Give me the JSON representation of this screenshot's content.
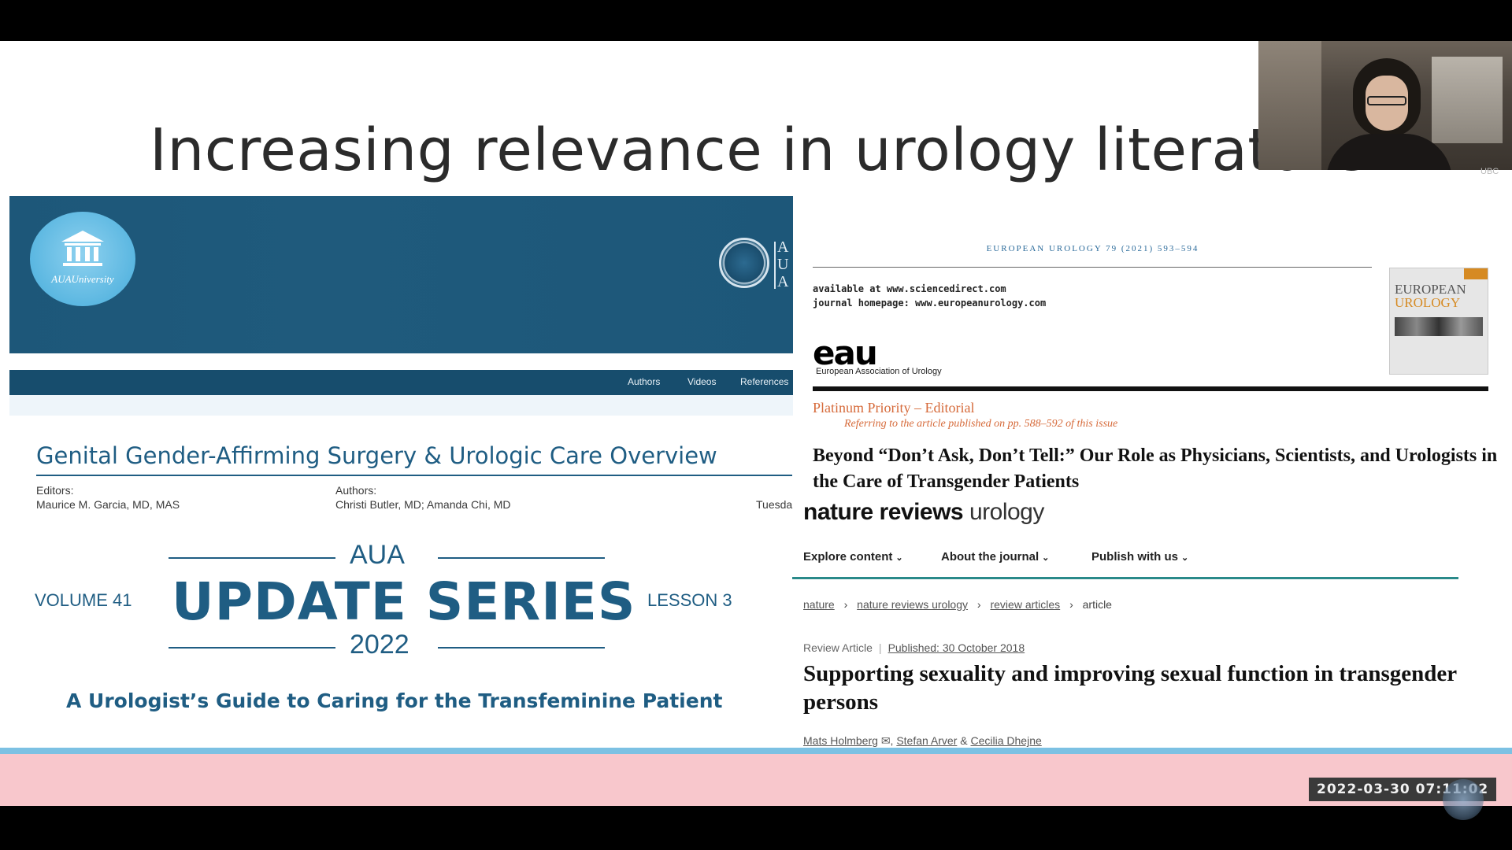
{
  "slide": {
    "title": "Increasing relevance in urology literature"
  },
  "aua_course": {
    "logo_text": "AUAUniversity",
    "seal_letters": [
      "A",
      "U",
      "A"
    ],
    "nav": [
      "Authors",
      "Videos",
      "References"
    ],
    "title": "Genital Gender-Affirming Surgery & Urologic Care Overview",
    "editors_label": "Editors:",
    "editors": "Maurice M. Garcia, MD, MAS",
    "authors_label": "Authors:",
    "authors": "Christi Butler, MD; Amanda Chi, MD",
    "date_fragment": "Tuesda"
  },
  "aua_update": {
    "aua": "AUA",
    "series": "UPDATE SERIES",
    "year": "2022",
    "volume": "VOLUME 41",
    "lesson": "LESSON 3",
    "guide": "A Urologist’s Guide to Caring for the Transfeminine Patient"
  },
  "european_urology": {
    "header": "EUROPEAN UROLOGY 79 (2021) 593–594",
    "available": "available at www.sciencedirect.com",
    "homepage": "journal homepage: www.europeanurology.com",
    "eau_logo": "eau",
    "eau_text": "European Association of Urology",
    "cover_title_1": "EUROPEAN",
    "cover_title_2": "UROLOGY",
    "priority": "Platinum Priority – Editorial",
    "referring": "Referring to the article published on pp. 588–592 of this issue",
    "article_title": "Beyond “Don’t Ask, Don’t Tell:” Our Role as Physicians, Scientists, and Urologists in the Care of Transgender Patients"
  },
  "nature_reviews": {
    "logo_bold": "nature reviews",
    "logo_light": "urology",
    "nav": [
      "Explore content",
      "About the journal",
      "Publish with us"
    ],
    "breadcrumbs": [
      "nature",
      "nature reviews urology",
      "review articles",
      "article"
    ],
    "article_type": "Review Article",
    "published": "Published: 30 October 2018",
    "title": "Supporting sexuality and improving sexual function in transgender persons",
    "authors": [
      "Mats Holmberg",
      "Stefan Arver",
      "Cecilia Dhejne"
    ],
    "author_sep_1": ",",
    "author_sep_2": "&"
  },
  "webcam": {
    "label": "UBC"
  },
  "timestamp": "2022-03-30 07:11:02",
  "colors": {
    "aua_blue": "#1f5d83",
    "aua_banner": "#1d5779",
    "eu_orange": "#d66a3a",
    "nature_teal": "#2a8a8a",
    "pink_band": "#f8c7cc",
    "blue_line": "#7cc1e3"
  }
}
